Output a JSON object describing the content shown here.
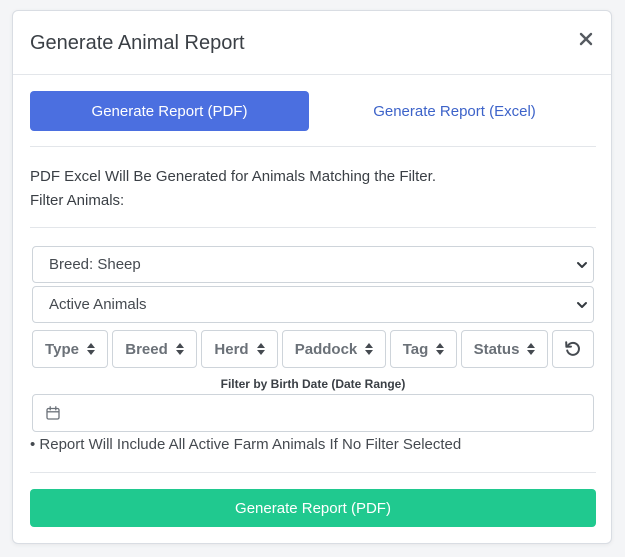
{
  "modal": {
    "title": "Generate Animal Report",
    "close_label": "×"
  },
  "tabs": {
    "pdf_label": "Generate Report (PDF)",
    "excel_label": "Generate Report (Excel)",
    "active": "pdf"
  },
  "info": {
    "line1": "PDF Excel Will Be Generated for Animals Matching the Filter.",
    "line2": "Filter Animals:"
  },
  "selects": {
    "breed_selected": "Breed: Sheep",
    "status_selected": "Active Animals"
  },
  "filters": [
    {
      "label": "Type"
    },
    {
      "label": "Breed"
    },
    {
      "label": "Herd"
    },
    {
      "label": "Paddock"
    },
    {
      "label": "Tag"
    },
    {
      "label": "Status"
    }
  ],
  "date_filter": {
    "label": "Filter by Birth Date (Date Range)",
    "value": ""
  },
  "note": "• Report Will Include All Active Farm Animals If No Filter Selected",
  "footer": {
    "generate_label": "Generate Report (PDF)"
  },
  "icons": {
    "close": "close-icon",
    "select_chevron": "chevron-down-icon",
    "sort": "sort-icon",
    "reset": "reset-icon",
    "calendar": "calendar-icon"
  },
  "colors": {
    "primary": "#4b6fe0",
    "link": "#3d63c9",
    "success": "#20c98f"
  }
}
